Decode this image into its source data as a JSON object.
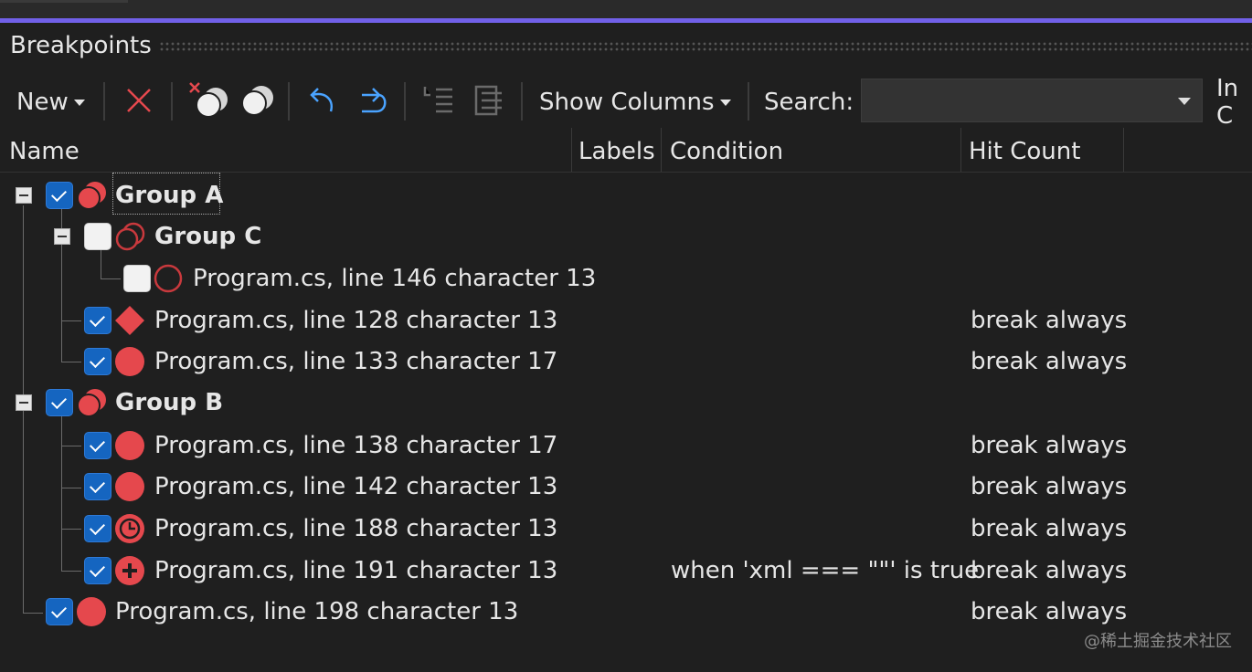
{
  "panel": {
    "title": "Breakpoints"
  },
  "toolbar": {
    "new_label": "New",
    "show_columns_label": "Show Columns",
    "search_label": "Search:",
    "search_value": "",
    "in_label": "In C"
  },
  "columns": {
    "name": "Name",
    "labels": "Labels",
    "condition": "Condition",
    "hit_count": "Hit Count"
  },
  "colors": {
    "accent": "#7160e8",
    "breakpoint_red": "#e5484d",
    "checkbox_blue": "#1565c0"
  },
  "tree": {
    "group_a": {
      "label": "Group A",
      "checked": true
    },
    "group_c": {
      "label": "Group C",
      "checked": false
    },
    "bp146": {
      "label": "Program.cs, line 146 character 13",
      "checked": false
    },
    "bp128": {
      "label": "Program.cs, line 128 character 13",
      "hit": "break always",
      "checked": true,
      "icon": "tracepoint-diamond-icon"
    },
    "bp133": {
      "label": "Program.cs, line 133 character 17",
      "hit": "break always",
      "checked": true
    },
    "group_b": {
      "label": "Group B",
      "checked": true
    },
    "bp138": {
      "label": "Program.cs, line 138 character 17",
      "hit": "break always",
      "checked": true
    },
    "bp142": {
      "label": "Program.cs, line 142 character 13",
      "hit": "break always",
      "checked": true
    },
    "bp188": {
      "label": "Program.cs, line 188 character 13",
      "hit": "break always",
      "checked": true,
      "icon": "temporary-breakpoint-icon"
    },
    "bp191": {
      "label": "Program.cs, line 191 character 13",
      "condition": "when 'xml === \"\"' is true",
      "hit": "break always",
      "checked": true,
      "icon": "dependent-breakpoint-icon"
    },
    "bp198": {
      "label": "Program.cs, line 198 character 13",
      "hit": "break always",
      "checked": true
    }
  },
  "watermark": "@稀土掘金技术社区"
}
